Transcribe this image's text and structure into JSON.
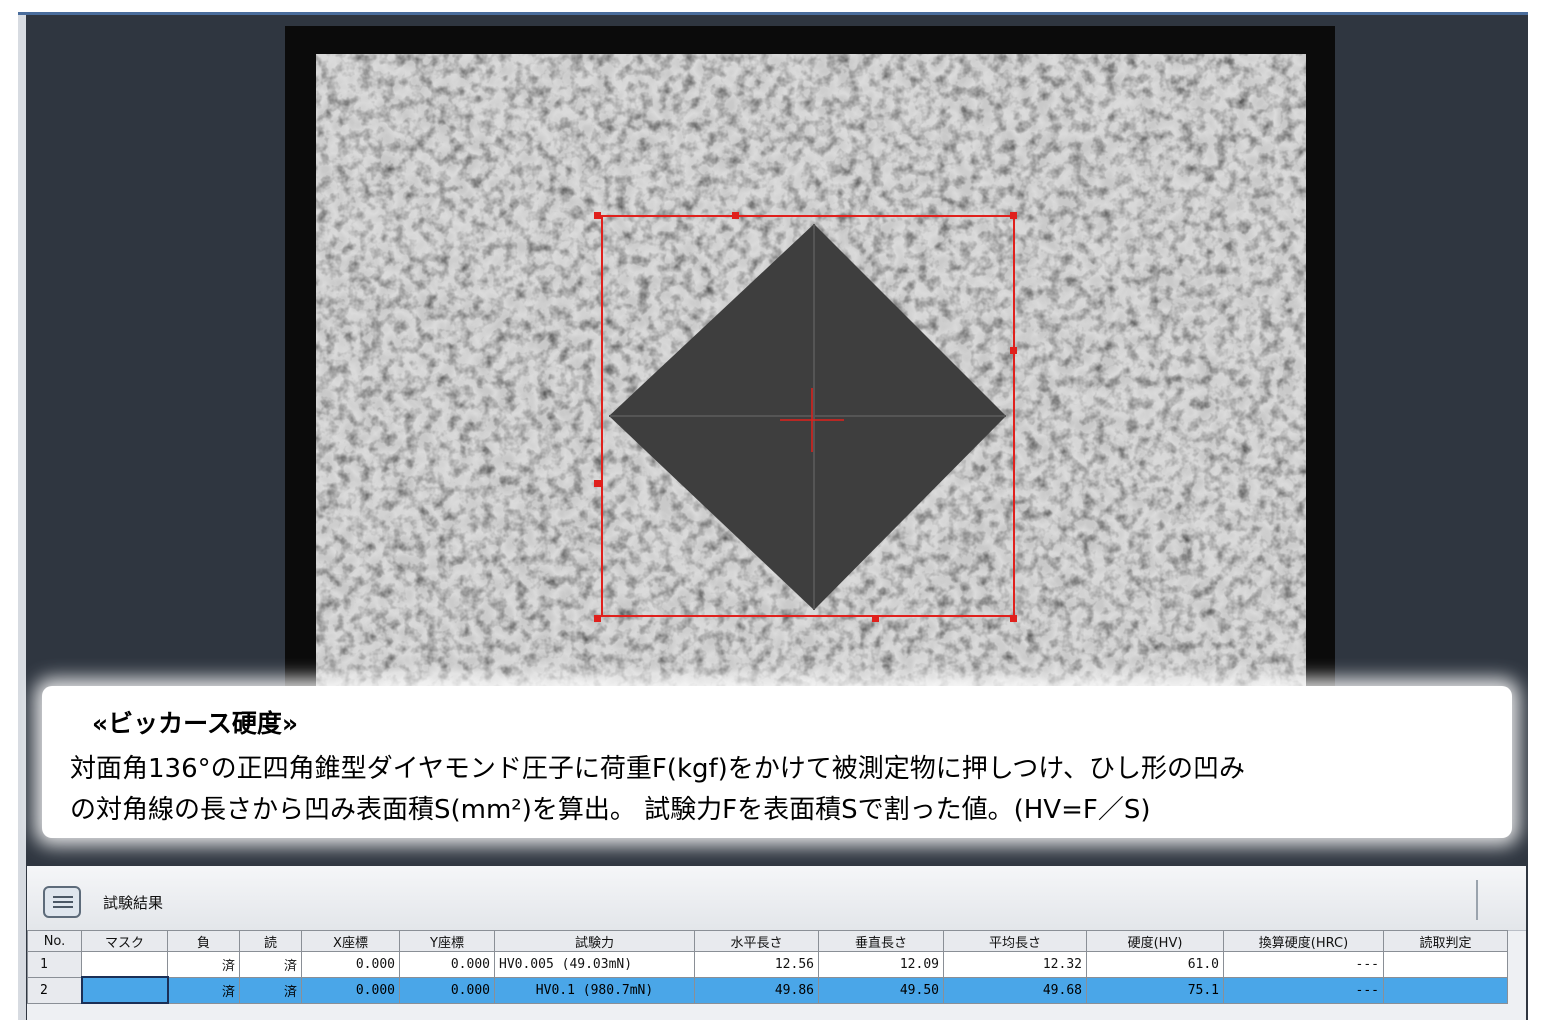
{
  "description": {
    "title": "«ビッカース硬度»",
    "line1": "対面角136°の正四角錐型ダイヤモンド圧子に荷重F(kgf)をかけて被測定物に押しつけ、ひし形の凹み",
    "line2": "の対角線の長さから凹み表面積S(mm²)を算出。 試験力Fを表面積Sで割った値。(HV=F／S)"
  },
  "results": {
    "title": "試験結果",
    "columns": [
      "No.",
      "マスク",
      "負",
      "読",
      "X座標",
      "Y座標",
      "試験力",
      "水平長さ",
      "垂直長さ",
      "平均長さ",
      "硬度(HV)",
      "換算硬度(HRC)",
      "読取判定"
    ],
    "rows": [
      {
        "no": "1",
        "mask": "",
        "load": "済",
        "read": "済",
        "x": "0.000",
        "y": "0.000",
        "force": "HV0.005 (49.03mN)",
        "h_len": "12.56",
        "v_len": "12.09",
        "avg_len": "12.32",
        "hv": "61.0",
        "hrc": "---",
        "judge": ""
      },
      {
        "no": "2",
        "mask": "",
        "load": "済",
        "read": "済",
        "x": "0.000",
        "y": "0.000",
        "force": "HV0.1 (980.7mN)",
        "h_len": "49.86",
        "v_len": "49.50",
        "avg_len": "49.68",
        "hv": "75.1",
        "hrc": "---",
        "judge": ""
      }
    ],
    "selected_row": 2
  },
  "colors": {
    "overlay_red": "#e0201c",
    "selection_blue": "#4aa6e8",
    "app_background": "#2f3640",
    "indent_dark": "#3e3e3e"
  },
  "icons": {
    "panel_icon": "list-folder-icon"
  }
}
